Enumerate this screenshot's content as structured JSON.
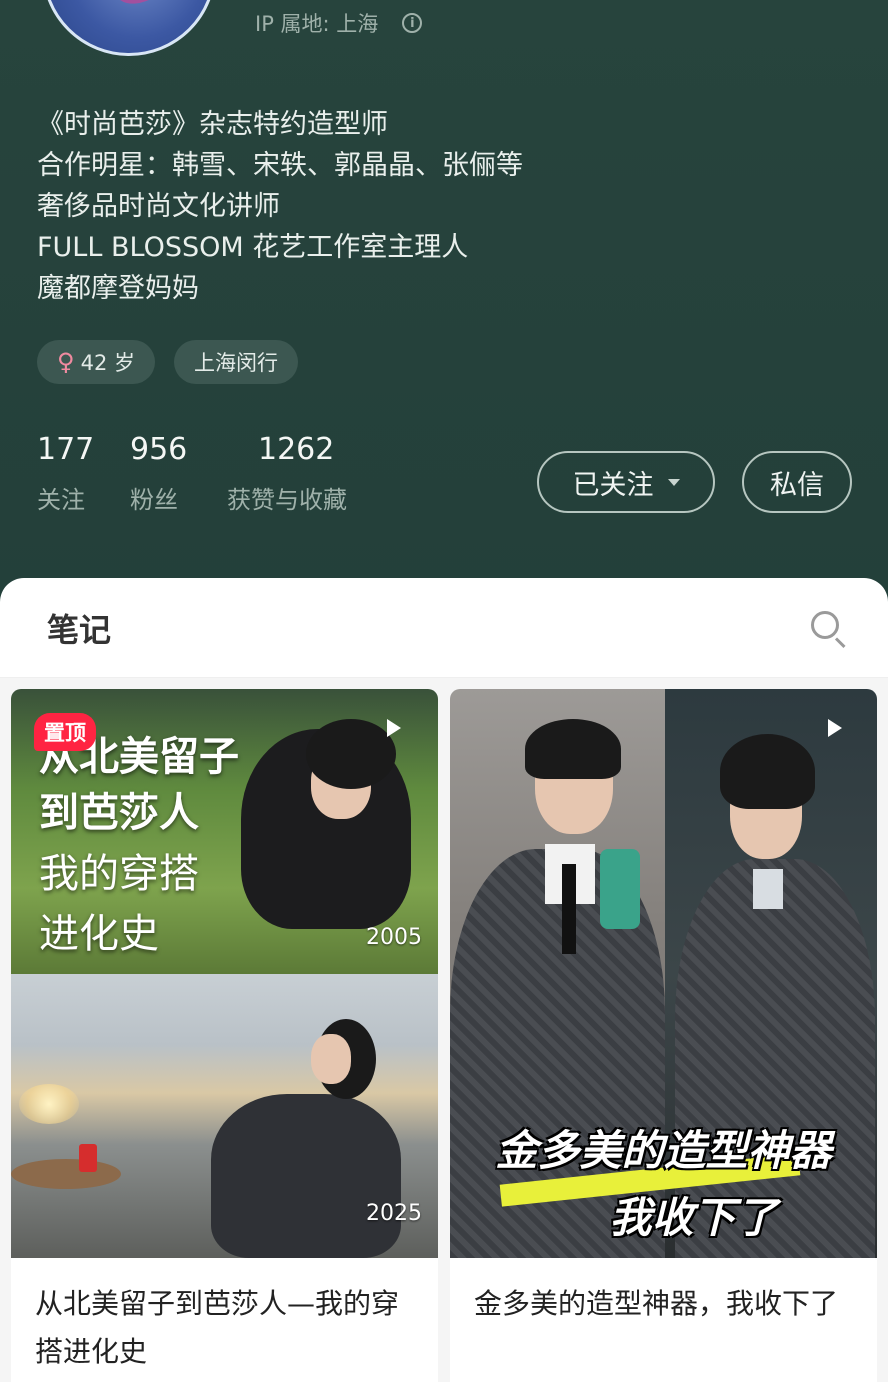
{
  "profile": {
    "ip_location": "IP 属地: 上海",
    "bio_lines": [
      "《时尚芭莎》杂志特约造型师",
      "合作明星：韩雪、宋轶、郭晶晶、张俪等",
      "奢侈品时尚文化讲师",
      "FULL BLOSSOM 花艺工作室主理人",
      "魔都摩登妈妈"
    ],
    "tags": {
      "age": "42 岁",
      "location": "上海闵行"
    },
    "stats": [
      {
        "value": "177",
        "label": "关注"
      },
      {
        "value": "956",
        "label": "粉丝"
      },
      {
        "value": "1262",
        "label": "获赞与收藏"
      }
    ],
    "follow_button": "已关注",
    "message_button": "私信"
  },
  "tabs": {
    "notes": "笔记"
  },
  "notes": [
    {
      "pinned_label": "置顶",
      "cover_text": [
        "从北美留子",
        "到芭莎人",
        "我的穿搭",
        "进化史"
      ],
      "year_top": "2005",
      "year_bottom": "2025",
      "caption": "从北美留子到芭莎人—我的穿搭进化史"
    },
    {
      "cover_text": [
        "金多美的造型神器",
        "我收下了"
      ],
      "caption": "金多美的造型神器，我收下了"
    }
  ],
  "colors": {
    "header_bg": "#25413b",
    "pin_badge": "#ff2442",
    "highlight": "#e8f03a"
  },
  "icons": [
    "female-icon",
    "info-icon",
    "search-icon",
    "play-icon",
    "caret-down-icon"
  ]
}
